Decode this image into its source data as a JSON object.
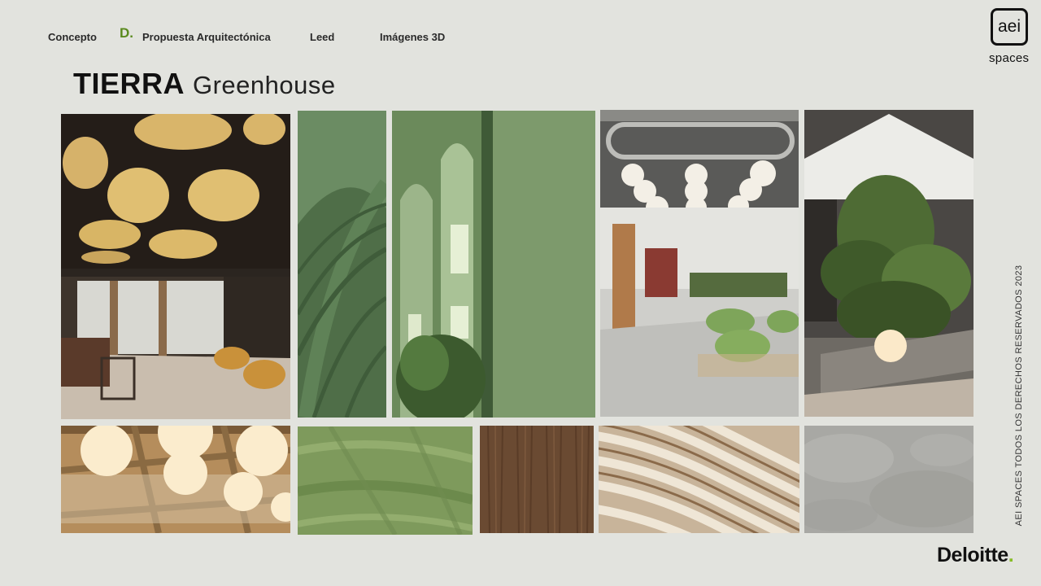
{
  "nav": {
    "items": [
      {
        "label": "Concepto"
      },
      {
        "label": "Propuesta  Arquitectónica"
      },
      {
        "label": "Leed"
      },
      {
        "label": "Imágenes 3D"
      }
    ],
    "active_marker": "D.",
    "marker_color": "#5a8a1e"
  },
  "title": {
    "main": "TIERRA",
    "sub": "Greenhouse"
  },
  "brand": {
    "logo_text": "aei",
    "logo_sub": "spaces"
  },
  "footer": {
    "copyright": "AEI SPACES TODOS LOS DERECHOS RESERVADOS 2023",
    "company": "Deloitte",
    "company_dot": ".",
    "company_dot_color": "#86bc25"
  },
  "moodboard": {
    "icons": [
      "restaurant-render-image",
      "leaf-texture-image",
      "green-arches-render-image",
      "office-lounge-render-image",
      "indoor-garden-render-image",
      "globe-pendant-ceiling-image",
      "green-fabric-swatch",
      "wood-veneer-swatch",
      "striped-rug-swatch",
      "concrete-swatch"
    ],
    "palette": {
      "green": "#6b7f55",
      "sage": "#7e9a6e",
      "wood": "#6a4a32",
      "sand": "#c8b49a",
      "concrete": "#a8a8a4"
    }
  }
}
